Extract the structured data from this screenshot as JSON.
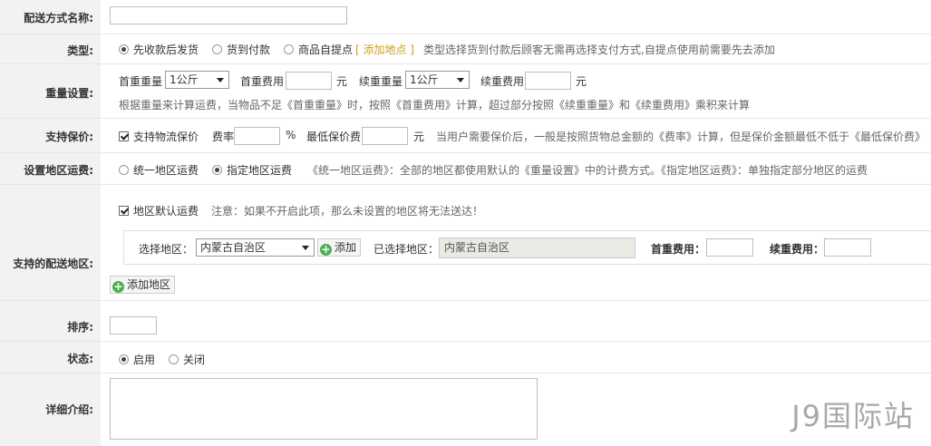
{
  "name_row": {
    "label": "配送方式名称:"
  },
  "type_row": {
    "label": "类型:",
    "options": [
      "先收款后发货",
      "货到付款",
      "商品自提点"
    ],
    "link": "[ 添加地点 ]",
    "hint": "类型选择货到付款后顾客无需再选择支付方式,自提点使用前需要先去添加"
  },
  "weight_row": {
    "label": "重量设置:",
    "first_weight_label": "首重重量",
    "first_weight_value": "1公斤",
    "first_fee_label": "首重费用",
    "yuan": "元",
    "cont_weight_label": "续重重量",
    "cont_weight_value": "1公斤",
    "cont_fee_label": "续重费用",
    "hint": "根据重量来计算运费，当物品不足《首重重量》时，按照《首重费用》计算，超过部分按照《续重重量》和《续重费用》乘积来计算"
  },
  "insure_row": {
    "label": "支持保价:",
    "checkbox_label": "支持物流保价",
    "rate_label": "费率",
    "percent": "%",
    "min_label": "最低保价费",
    "yuan": "元",
    "hint": "当用户需要保价后，一般是按照货物总金额的《费率》计算，但是保价金额最低不低于《最低保价费》"
  },
  "area_row": {
    "label": "设置地区运费:",
    "options": [
      "统一地区运费",
      "指定地区运费"
    ],
    "hint": "《统一地区运费》：全部的地区都使用默认的《重量设置》中的计费方式。《指定地区运费》：单独指定部分地区的运费"
  },
  "region_row": {
    "label": "支持的配送地区:",
    "default_label": "地区默认运费",
    "default_hint": "注意：如果不开启此项，那么未设置的地区将无法送达！",
    "select_label": "选择地区：",
    "select_value": "内蒙古自治区",
    "add_label": "添加",
    "selected_label": "已选择地区：",
    "selected_value": "内蒙古自治区",
    "first_fee_label": "首重费用：",
    "cont_fee_label": "续重费用：",
    "add_region_label": "添加地区"
  },
  "sort_row": {
    "label": "排序:"
  },
  "status_row": {
    "label": "状态:",
    "options": [
      "启用",
      "关闭"
    ]
  },
  "detail_row": {
    "label": "详细介绍:"
  },
  "watermark": "J9国际站"
}
